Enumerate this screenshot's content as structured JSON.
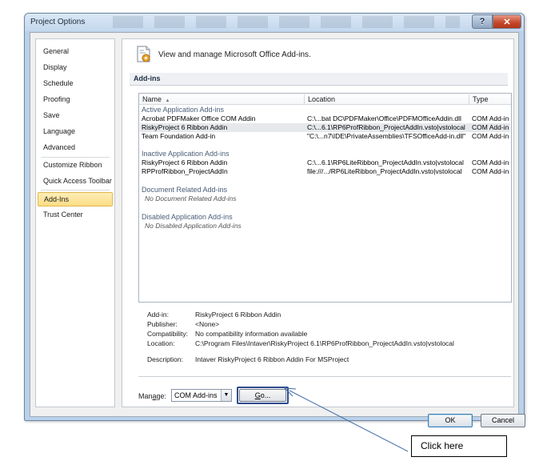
{
  "window": {
    "title": "Project Options",
    "help_glyph": "?",
    "close_glyph": "✕"
  },
  "nav": {
    "items": [
      {
        "id": "general",
        "label": "General"
      },
      {
        "id": "display",
        "label": "Display"
      },
      {
        "id": "schedule",
        "label": "Schedule"
      },
      {
        "id": "proofing",
        "label": "Proofing"
      },
      {
        "id": "save",
        "label": "Save"
      },
      {
        "id": "language",
        "label": "Language"
      },
      {
        "id": "advanced",
        "label": "Advanced"
      },
      {
        "id": "customize-ribbon",
        "label": "Customize Ribbon"
      },
      {
        "id": "quick-access-toolbar",
        "label": "Quick Access Toolbar"
      },
      {
        "id": "add-ins",
        "label": "Add-Ins"
      },
      {
        "id": "trust-center",
        "label": "Trust Center"
      }
    ],
    "selected": "Add-Ins"
  },
  "header": {
    "text": "View and manage Microsoft Office Add-ins.",
    "icon": "gear-addin-icon"
  },
  "section": {
    "title": "Add-ins"
  },
  "table": {
    "columns": {
      "name": "Name",
      "sort_indicator": "▲",
      "location": "Location",
      "type": "Type"
    },
    "groups": [
      {
        "title": "Active Application Add-ins",
        "rows": [
          {
            "name": "Acrobat PDFMaker Office COM Addin",
            "location": "C:\\...bat DC\\PDFMaker\\Office\\PDFMOfficeAddin.dll",
            "type": "COM Add-in"
          },
          {
            "name": "RiskyProject 6 Ribbon Addin",
            "location": "C:\\...6.1\\RP6ProfRibbon_ProjectAddIn.vsto|vstolocal",
            "type": "COM Add-in"
          },
          {
            "name": "Team Foundation Add-in",
            "location": "\"C:\\...n7\\IDE\\PrivateAssemblies\\TFSOfficeAdd-in.dll\"",
            "type": "COM Add-in"
          }
        ]
      },
      {
        "title": "Inactive Application Add-ins",
        "rows": [
          {
            "name": "RiskyProject 6 Ribbon Addin",
            "location": "C:\\...6.1\\RP6LiteRibbon_ProjectAddIn.vsto|vstolocal",
            "type": "COM Add-in"
          },
          {
            "name": "RPProfRibbon_ProjectAddIn",
            "location": "file:///.../RP6LiteRibbon_ProjectAddIn.vsto|vstolocal",
            "type": "COM Add-in"
          }
        ]
      },
      {
        "title": "Document Related Add-ins",
        "empty": "No Document Related Add-ins"
      },
      {
        "title": "Disabled Application Add-ins",
        "empty": "No Disabled Application Add-ins"
      }
    ]
  },
  "details": {
    "addin": {
      "label": "Add-in:",
      "value": "RiskyProject 6 Ribbon Addin"
    },
    "publisher": {
      "label": "Publisher:",
      "value": "<None>"
    },
    "compatibility": {
      "label": "Compatibility:",
      "value": "No compatibility information available"
    },
    "location": {
      "label": "Location:",
      "value": "C:\\Program Files\\Intaver\\RiskyProject 6.1\\RP6ProfRibbon_ProjectAddIn.vsto|vstolocal"
    },
    "description": {
      "label": "Description:",
      "value": "Intaver RiskyProject 6 Ribbon Addin For MSProject"
    }
  },
  "manage": {
    "label_prefix": "Man",
    "label_accel": "a",
    "label_suffix": "ge:",
    "value": "COM Add-ins",
    "dropdown_glyph": "▼",
    "go_accel": "G",
    "go_rest": "o..."
  },
  "footer": {
    "ok": "OK",
    "cancel": "Cancel"
  },
  "callout": {
    "text": "Click here"
  }
}
